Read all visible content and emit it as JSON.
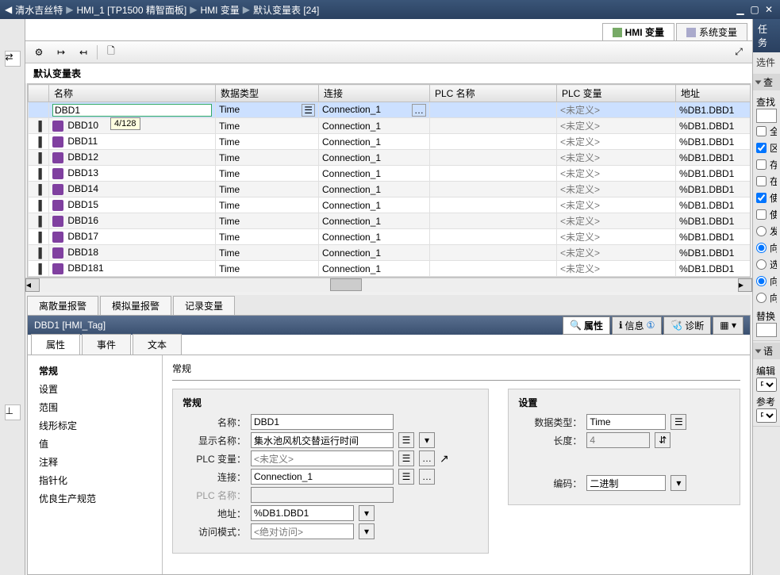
{
  "titlebar": {
    "crumbs": [
      "清水吉丝特",
      "HMI_1 [TP1500 精智面板]",
      "HMI 变量",
      "默认变量表 [24]"
    ]
  },
  "right_title": "任务",
  "right_subtitle": "选件",
  "toptabs": {
    "hmi": "HMI 变量",
    "sys": "系统变量"
  },
  "table": {
    "title": "默认变量表",
    "headers": {
      "name": "名称",
      "dtype": "数据类型",
      "conn": "连接",
      "plcname": "PLC 名称",
      "plcvar": "PLC 变量",
      "addr": "地址"
    },
    "tooltip": "4/128",
    "editing_value": "DBD1",
    "rows": [
      {
        "name": "DBD1",
        "dtype": "Time",
        "conn": "Connection_1",
        "plcvar": "<未定义>",
        "addr": "%DB1.DBD1"
      },
      {
        "name": "DBD10",
        "dtype": "Time",
        "conn": "Connection_1",
        "plcvar": "<未定义>",
        "addr": "%DB1.DBD1"
      },
      {
        "name": "DBD11",
        "dtype": "Time",
        "conn": "Connection_1",
        "plcvar": "<未定义>",
        "addr": "%DB1.DBD1"
      },
      {
        "name": "DBD12",
        "dtype": "Time",
        "conn": "Connection_1",
        "plcvar": "<未定义>",
        "addr": "%DB1.DBD1"
      },
      {
        "name": "DBD13",
        "dtype": "Time",
        "conn": "Connection_1",
        "plcvar": "<未定义>",
        "addr": "%DB1.DBD1"
      },
      {
        "name": "DBD14",
        "dtype": "Time",
        "conn": "Connection_1",
        "plcvar": "<未定义>",
        "addr": "%DB1.DBD1"
      },
      {
        "name": "DBD15",
        "dtype": "Time",
        "conn": "Connection_1",
        "plcvar": "<未定义>",
        "addr": "%DB1.DBD1"
      },
      {
        "name": "DBD16",
        "dtype": "Time",
        "conn": "Connection_1",
        "plcvar": "<未定义>",
        "addr": "%DB1.DBD1"
      },
      {
        "name": "DBD17",
        "dtype": "Time",
        "conn": "Connection_1",
        "plcvar": "<未定义>",
        "addr": "%DB1.DBD1"
      },
      {
        "name": "DBD18",
        "dtype": "Time",
        "conn": "Connection_1",
        "plcvar": "<未定义>",
        "addr": "%DB1.DBD1"
      },
      {
        "name": "DBD181",
        "dtype": "Time",
        "conn": "Connection_1",
        "plcvar": "<未定义>",
        "addr": "%DB1.DBD1"
      }
    ]
  },
  "lowertabs": {
    "discrete": "离散量报警",
    "analog": "模拟量报警",
    "log": "记录变量"
  },
  "inspector": {
    "title": "DBD1 [HMI_Tag]",
    "rtabs": {
      "prop": "属性",
      "info": "信息",
      "diag": "诊断"
    },
    "infobadge": "①",
    "ptabs": {
      "prop": "属性",
      "event": "事件",
      "text": "文本"
    },
    "navitems": [
      "常规",
      "设置",
      "范围",
      "线形标定",
      "值",
      "注释",
      "指针化",
      "优良生产规范"
    ],
    "group_general_outer": "常规",
    "group_general": "常规",
    "group_settings": "设置",
    "fields": {
      "name_l": "名称：",
      "name_v": "DBD1",
      "disp_l": "显示名称：",
      "disp_v": "集水池风机交替运行时间",
      "plcvar_l": "PLC 变量：",
      "plcvar_v": "<未定义>",
      "conn_l": "连接：",
      "conn_v": "Connection_1",
      "plcname_l": "PLC 名称：",
      "plcname_v": "",
      "addr_l": "地址：",
      "addr_v": "%DB1.DBD1",
      "mode_l": "访问模式：",
      "mode_v": "<绝对访问>",
      "dtype_l": "数据类型：",
      "dtype_v": "Time",
      "len_l": "长度：",
      "len_v": "4",
      "enc_l": "编码：",
      "enc_v": "二进制"
    }
  },
  "rightpanel": {
    "searchhead": "查",
    "searchlab": "查找",
    "opts": {
      "a": "全",
      "b": "区",
      "c": "存",
      "d": "在",
      "e": "使",
      "f": "使"
    },
    "radios": {
      "r1": "发",
      "r2": "向",
      "r3": "选"
    },
    "repl": "替换",
    "langhead": "语",
    "edlab": "编辑",
    "edval": "中文",
    "reflab": "参考",
    "refval": "中文"
  }
}
